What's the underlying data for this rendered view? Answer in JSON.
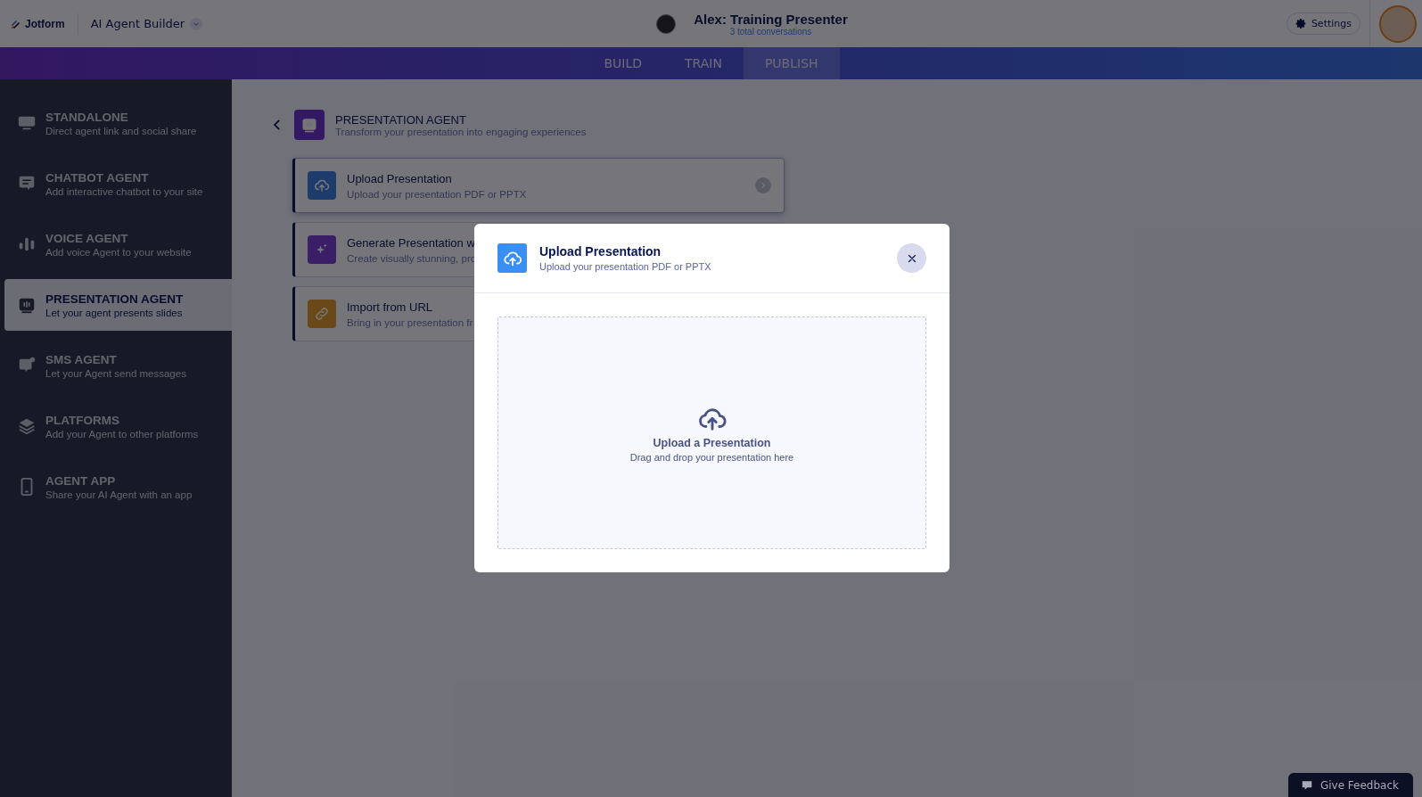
{
  "header": {
    "logo": "Jotform",
    "product": "AI Agent Builder",
    "agent_title": "Alex: Training Presenter",
    "conversations": "3 total conversations",
    "settings": "Settings"
  },
  "tabs": [
    {
      "label": "BUILD",
      "selected": false
    },
    {
      "label": "TRAIN",
      "selected": false
    },
    {
      "label": "PUBLISH",
      "selected": true
    }
  ],
  "sidebar": {
    "items": [
      {
        "kind": "standalone",
        "title": "STANDALONE",
        "subtitle": "Direct agent link and social share",
        "selected": false
      },
      {
        "kind": "chatbot",
        "title": "CHATBOT AGENT",
        "subtitle": "Add interactive chatbot to your site",
        "selected": false
      },
      {
        "kind": "voice",
        "title": "VOICE AGENT",
        "subtitle": "Add voice Agent to your website",
        "selected": false
      },
      {
        "kind": "presentation",
        "title": "PRESENTATION AGENT",
        "subtitle": "Let your agent presents slides",
        "selected": true
      },
      {
        "kind": "sms",
        "title": "SMS AGENT",
        "subtitle": "Let your Agent send messages",
        "selected": false
      },
      {
        "kind": "platforms",
        "title": "PLATFORMS",
        "subtitle": "Add your Agent to other platforms",
        "selected": false
      },
      {
        "kind": "app",
        "title": "AGENT APP",
        "subtitle": "Share your AI Agent with an app",
        "selected": false
      }
    ]
  },
  "main": {
    "title": "PRESENTATION AGENT",
    "subtitle": "Transform your presentation into engaging experiences",
    "options": [
      {
        "kind": "upload",
        "title": "Upload Presentation",
        "subtitle": "Upload your presentation PDF or PPTX",
        "hovered": true
      },
      {
        "kind": "generate",
        "title": "Generate Presentation w",
        "subtitle": "Create visually stunning, pro",
        "hovered": false
      },
      {
        "kind": "url",
        "title": "Import from URL",
        "subtitle": "Bring in your presentation fr",
        "hovered": false
      }
    ]
  },
  "modal": {
    "title": "Upload Presentation",
    "subtitle": "Upload your presentation PDF or PPTX",
    "drop_title": "Upload a Presentation",
    "drop_hint": "Drag and drop your presentation here"
  },
  "feedback": "Give Feedback"
}
